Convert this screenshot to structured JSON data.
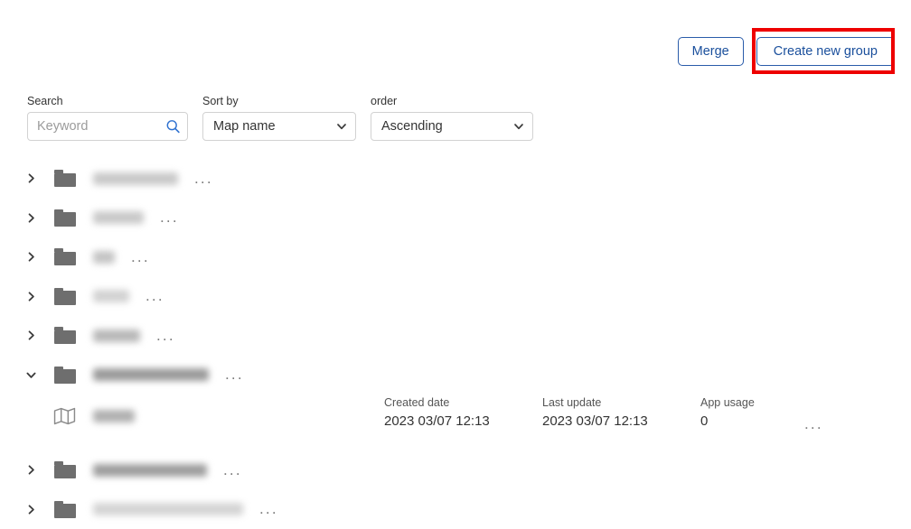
{
  "toolbar": {
    "merge_label": "Merge",
    "create_label": "Create new group",
    "accent_color": "#1a4f9c",
    "highlight_color": "#ee0000"
  },
  "filters": {
    "search": {
      "label": "Search",
      "placeholder": "Keyword",
      "value": "",
      "icon": "search-icon",
      "icon_color": "#2f72d0"
    },
    "sort_by": {
      "label": "Sort by",
      "value": "Map name",
      "icon": "chevron-down-icon"
    },
    "order": {
      "label": "order",
      "value": "Ascending",
      "icon": "chevron-down-icon"
    }
  },
  "tree": {
    "rows": [
      {
        "type": "group",
        "expanded": false,
        "chevron": "chevron-right-icon",
        "icon": "folder-icon",
        "name_redacted": true,
        "name_width": 94,
        "name_shade": "#c9c9c9",
        "menu": "..."
      },
      {
        "type": "group",
        "expanded": false,
        "chevron": "chevron-right-icon",
        "icon": "folder-icon",
        "name_redacted": true,
        "name_width": 56,
        "name_shade": "#c9c9c9",
        "menu": "..."
      },
      {
        "type": "group",
        "expanded": false,
        "chevron": "chevron-right-icon",
        "icon": "folder-icon",
        "name_redacted": true,
        "name_width": 24,
        "name_shade": "#c4c4c4",
        "menu": "..."
      },
      {
        "type": "group",
        "expanded": false,
        "chevron": "chevron-right-icon",
        "icon": "folder-icon",
        "name_redacted": true,
        "name_width": 40,
        "name_shade": "#d2d2d2",
        "menu": "..."
      },
      {
        "type": "group",
        "expanded": false,
        "chevron": "chevron-right-icon",
        "icon": "folder-icon",
        "name_redacted": true,
        "name_width": 52,
        "name_shade": "#b8b8b8",
        "menu": "..."
      },
      {
        "type": "group",
        "expanded": true,
        "chevron": "chevron-down-icon",
        "icon": "folder-icon",
        "name_redacted": true,
        "name_width": 128,
        "name_shade": "#9a9a9a",
        "menu": "..."
      },
      {
        "type": "map",
        "icon": "map-icon",
        "name_redacted": true,
        "name_width": 46,
        "name_shade": "#b0b0b0",
        "menu": "...",
        "created_label": "Created date",
        "created_value": "2023 03/07 12:13",
        "updated_label": "Last update",
        "updated_value": "2023 03/07 12:13",
        "usage_label": "App usage",
        "usage_value": "0"
      },
      {
        "type": "group",
        "expanded": false,
        "chevron": "chevron-right-icon",
        "icon": "folder-icon",
        "name_redacted": true,
        "name_width": 126,
        "name_shade": "#9e9e9e",
        "menu": "..."
      },
      {
        "type": "group",
        "expanded": false,
        "chevron": "chevron-right-icon",
        "icon": "folder-icon",
        "name_redacted": true,
        "name_width": 166,
        "name_shade": "#d4d4d4",
        "menu": "..."
      }
    ]
  }
}
